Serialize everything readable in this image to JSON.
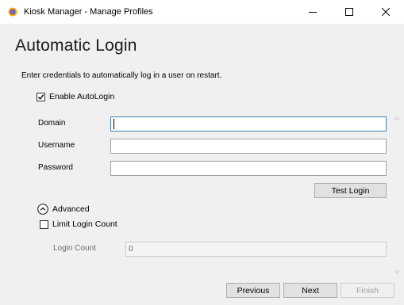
{
  "window": {
    "title": "Kiosk Manager - Manage Profiles",
    "app_icon": "kiosk-manager-icon",
    "minimize_icon": "minimize-icon",
    "maximize_icon": "maximize-icon",
    "close_icon": "close-icon"
  },
  "page": {
    "heading": "Automatic Login",
    "description": "Enter credentials to automatically log in a user on restart."
  },
  "autologin": {
    "label": "Enable AutoLogin",
    "checked": true
  },
  "fields": {
    "domain_label": "Domain",
    "domain_value": "",
    "username_label": "Username",
    "username_value": "",
    "password_label": "Password",
    "password_value": ""
  },
  "test_login_label": "Test Login",
  "advanced": {
    "label": "Advanced",
    "expander_icon": "chevron-up-circle-icon",
    "expanded": true,
    "limit_label": "Limit Login Count",
    "limit_checked": false,
    "count_label": "Login Count",
    "count_value": "0"
  },
  "footer": {
    "previous_label": "Previous",
    "next_label": "Next",
    "finish_label": "Finish"
  },
  "colors": {
    "focus_border": "#3c7fb1",
    "window_bg": "#f0f0f0",
    "titlebar_bg": "#ffffff"
  }
}
